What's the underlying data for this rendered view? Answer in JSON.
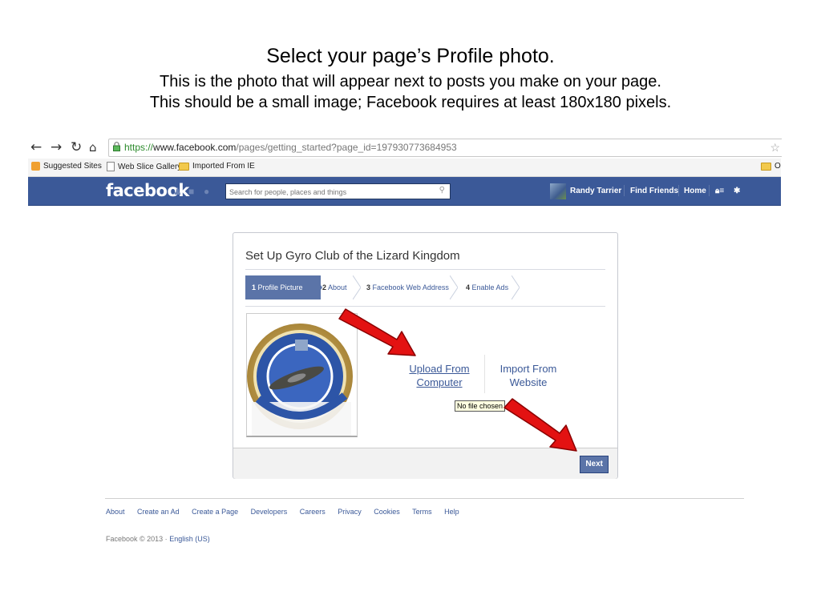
{
  "slide": {
    "title": "Select your page’s Profile photo.",
    "line1": "This is the photo that will appear next to posts you make on your page.",
    "line2": "This should be a small image; Facebook requires at least 180x180 pixels."
  },
  "browser": {
    "url_scheme": "https://",
    "url_host": "www.facebook.com",
    "url_path": "/pages/getting_started?page_id=197930773684953",
    "bookmarks": [
      "Suggested Sites",
      "Web Slice Gallery",
      "Imported From IE"
    ],
    "bookmark_right": "O"
  },
  "fbbar": {
    "logo": "facebook",
    "search_placeholder": "Search for people, places and things",
    "user_name": "Randy Tarrier",
    "find_friends": "Find Friends",
    "home": "Home"
  },
  "dialog": {
    "title": "Set Up Gyro Club of the Lizard Kingdom",
    "steps": [
      {
        "num": "1",
        "label": "Profile Picture"
      },
      {
        "num": "2",
        "label": "About"
      },
      {
        "num": "3",
        "label": "Facebook Web Address"
      },
      {
        "num": "4",
        "label": "Enable Ads"
      }
    ],
    "upload_line1": "Upload From",
    "upload_line2": "Computer",
    "import_line1": "Import From",
    "import_line2": "Website",
    "tooltip": "No file chosen",
    "next_label": "Next"
  },
  "footer": {
    "links": [
      "About",
      "Create an Ad",
      "Create a Page",
      "Developers",
      "Careers",
      "Privacy",
      "Cookies",
      "Terms",
      "Help"
    ],
    "copyright": "Facebook © 2013 · ",
    "language": "English (US)"
  },
  "colors": {
    "fb_blue": "#3b5998",
    "step_active": "#5b74a8",
    "arrow_red": "#e31212"
  }
}
